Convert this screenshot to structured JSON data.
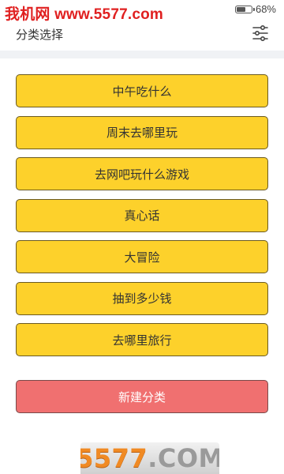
{
  "status_bar": {
    "battery_text": "68%",
    "battery_level": 0.68
  },
  "watermark_top": "我机网 www.5577.com",
  "header": {
    "title": "分类选择",
    "filter_icon": "filter-sliders-icon"
  },
  "categories": [
    {
      "label": "中午吃什么"
    },
    {
      "label": "周末去哪里玩"
    },
    {
      "label": "去网吧玩什么游戏"
    },
    {
      "label": "真心话"
    },
    {
      "label": "大冒险"
    },
    {
      "label": "抽到多少钱"
    },
    {
      "label": "去哪里旅行"
    }
  ],
  "new_category_label": "新建分类",
  "watermark_bottom": {
    "digits": "5577",
    "dot": ".",
    "com": "COM"
  },
  "colors": {
    "category_bg": "#fdd12b",
    "new_category_bg": "#f07070",
    "watermark_red": "#e02020"
  }
}
